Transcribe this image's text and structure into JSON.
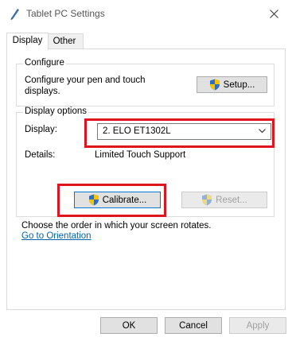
{
  "window": {
    "title": "Tablet PC Settings"
  },
  "tabs": [
    {
      "label": "Display"
    },
    {
      "label": "Other"
    }
  ],
  "configure": {
    "title": "Configure",
    "description_line1": "Configure your pen and touch",
    "description_line2": "displays.",
    "setup_button": "Setup..."
  },
  "display_options": {
    "title": "Display options",
    "display_label": "Display:",
    "display_value": "2. ELO ET1302L",
    "details_label": "Details:",
    "details_value": "Limited Touch Support",
    "calibrate_button": "Calibrate...",
    "reset_button": "Reset..."
  },
  "orientation": {
    "text": "Choose the order in which your screen rotates.",
    "link": "Go to Orientation"
  },
  "footer": {
    "ok": "OK",
    "cancel": "Cancel",
    "apply": "Apply"
  },
  "colors": {
    "highlight": "#e0141e",
    "link": "#0063b1",
    "accent": "#0078d7"
  }
}
